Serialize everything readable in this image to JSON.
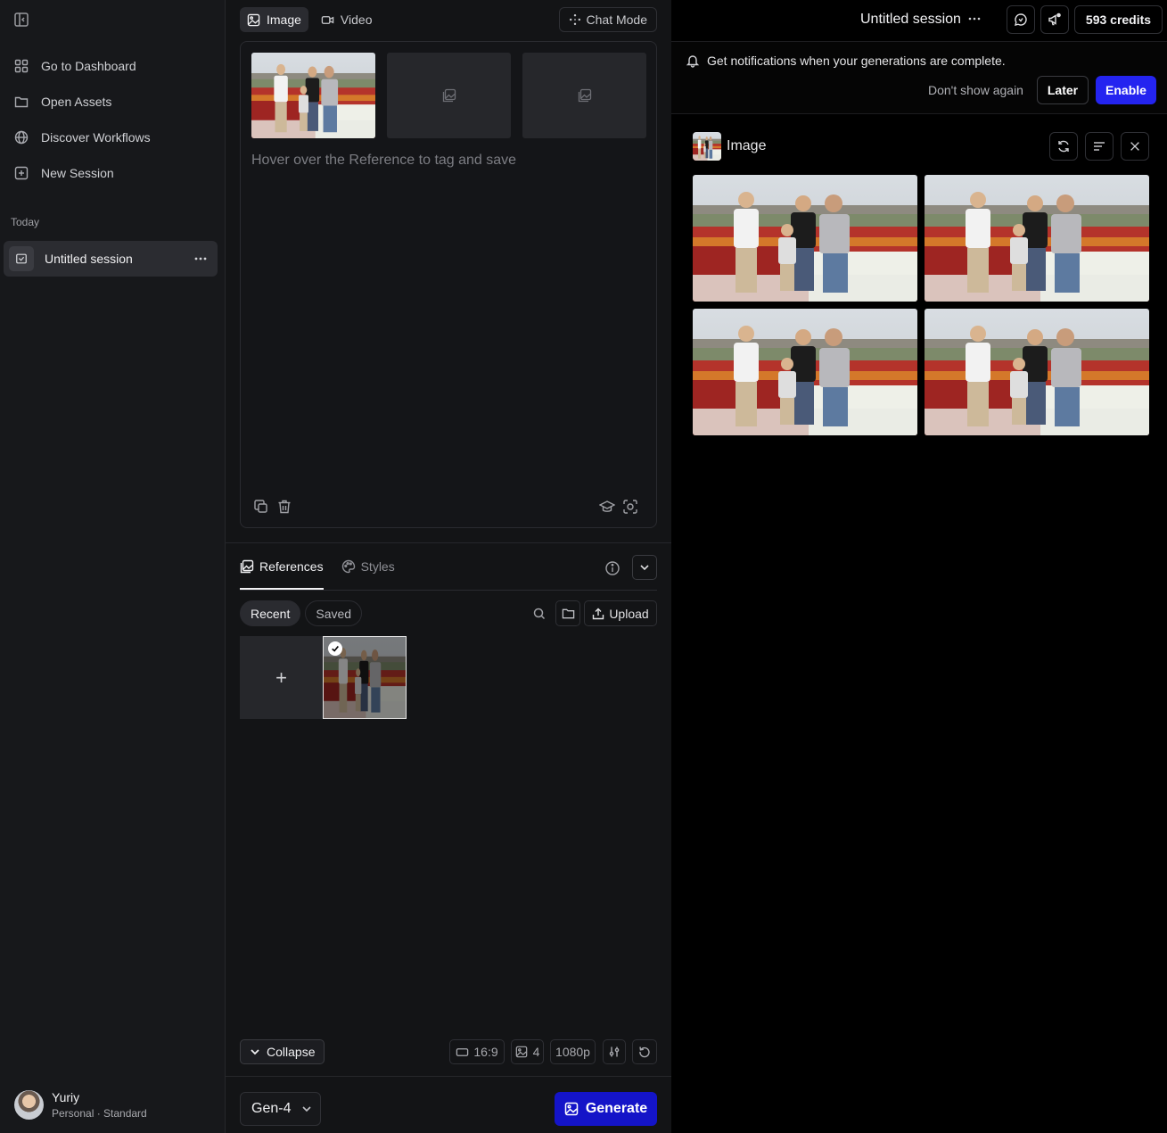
{
  "sidebar": {
    "nav": [
      {
        "label": "Go to Dashboard",
        "icon": "grid-icon"
      },
      {
        "label": "Open Assets",
        "icon": "folder-icon"
      },
      {
        "label": "Discover Workflows",
        "icon": "globe-icon"
      },
      {
        "label": "New Session",
        "icon": "plus-square-icon"
      }
    ],
    "section_label": "Today",
    "session_label": "Untitled session",
    "user": {
      "name": "Yuriy",
      "plan": "Personal · Standard"
    }
  },
  "composer": {
    "tabs": [
      {
        "label": "Image",
        "icon": "image-icon",
        "active": true
      },
      {
        "label": "Video",
        "icon": "video-icon",
        "active": false
      }
    ],
    "chat_mode_label": "Chat Mode",
    "prompt_placeholder": "Hover over the Reference to tag and save",
    "references": {
      "tabs": [
        {
          "label": "References",
          "active": true
        },
        {
          "label": "Styles",
          "active": false
        }
      ],
      "filters": [
        {
          "label": "Recent",
          "active": true
        },
        {
          "label": "Saved",
          "active": false
        }
      ],
      "upload_label": "Upload",
      "add_symbol": "+"
    },
    "settings": {
      "collapse_label": "Collapse",
      "aspect_ratio": "16:9",
      "image_count": "4",
      "resolution": "1080p"
    },
    "model_label": "Gen-4",
    "generate_label": "Generate"
  },
  "session": {
    "title": "Untitled session",
    "credits_label": "593 credits",
    "notification": {
      "text": "Get notifications when your generations are complete.",
      "dont_show_label": "Don't show again",
      "later_label": "Later",
      "enable_label": "Enable"
    },
    "result_label": "Image",
    "result_count": 4
  },
  "colors": {
    "accent": "#1414c8",
    "enable": "#2424f0",
    "sidebar_bg": "#17181b",
    "panel_bg": "#131416",
    "output_bg": "#000000"
  }
}
